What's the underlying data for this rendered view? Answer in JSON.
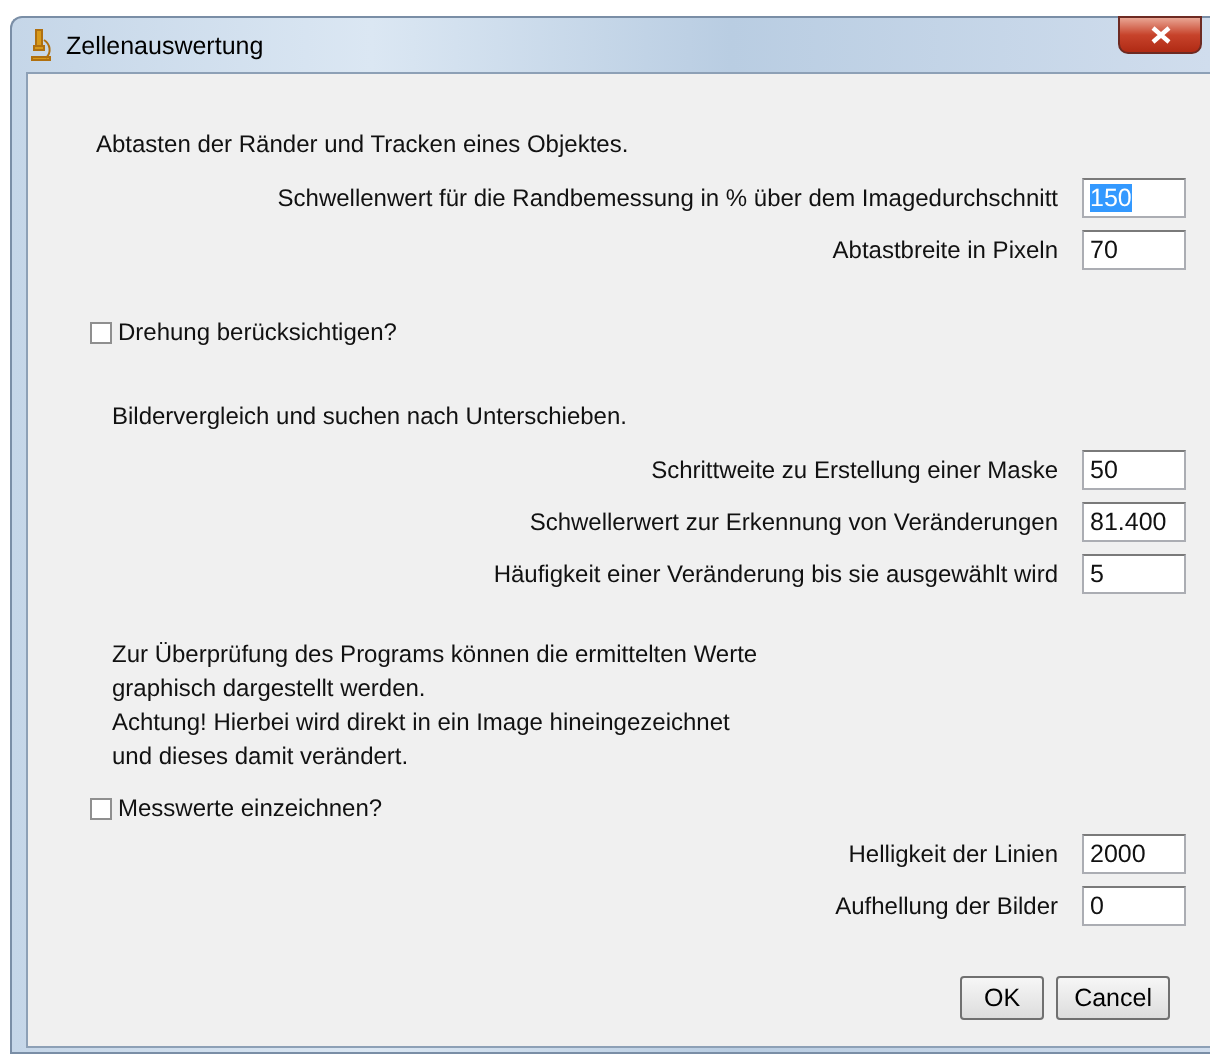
{
  "window": {
    "title": "Zellenauswertung"
  },
  "sections": [
    {
      "kind": "heading",
      "text": "Abtasten der Ränder und Tracken eines Objektes."
    },
    {
      "kind": "field",
      "label": "Schwellenwert für die Randbemessung in % über dem Imagedurchschnitt",
      "value": "150",
      "text_selected": true
    },
    {
      "kind": "field",
      "label": "Abtastbreite in Pixeln",
      "value": "70",
      "text_selected": false
    },
    {
      "kind": "checkbox",
      "label": "Drehung berücksichtigen?",
      "checked": false
    },
    {
      "kind": "heading",
      "text": "Bildervergleich und suchen nach Unterschieben."
    },
    {
      "kind": "field",
      "label": "Schrittweite zu Erstellung einer Maske",
      "value": "50",
      "text_selected": false
    },
    {
      "kind": "field",
      "label": "Schwellerwert zur Erkennung von Veränderungen",
      "value": "81.400",
      "text_selected": false
    },
    {
      "kind": "field",
      "label": "Häufigkeit einer Veränderung bis sie ausgewählt wird",
      "value": "5",
      "text_selected": false
    },
    {
      "kind": "note",
      "lines": [
        "Zur Überprüfung des Programs können die ermittelten Werte",
        "graphisch dargestellt werden.",
        "Achtung! Hierbei wird direkt in ein Image hineingezeichnet",
        "und dieses damit verändert."
      ]
    },
    {
      "kind": "checkbox",
      "label": "Messwerte einzeichnen?",
      "checked": false
    },
    {
      "kind": "field",
      "label": "Helligkeit der Linien",
      "value": "2000",
      "text_selected": false
    },
    {
      "kind": "field",
      "label": "Aufhellung der Bilder",
      "value": "0",
      "text_selected": false
    }
  ],
  "buttons": [
    "OK",
    "Cancel"
  ]
}
